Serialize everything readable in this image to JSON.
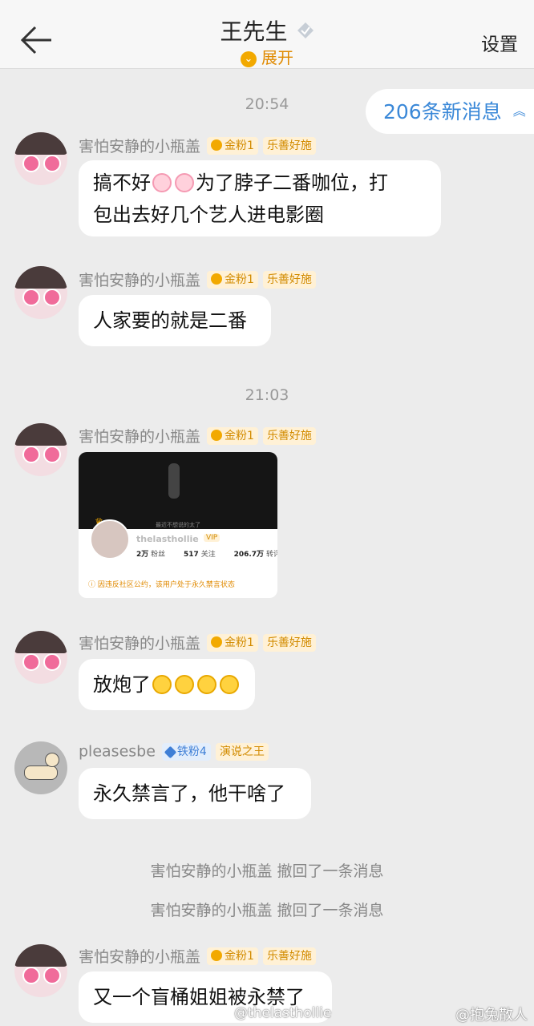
{
  "header": {
    "title": "王先生",
    "expand_label": "展开",
    "settings_label": "设置"
  },
  "new_messages": {
    "label": "206条新消息"
  },
  "times": [
    "20:54",
    "21:03"
  ],
  "user1": {
    "name": "害怕安静的小瓶盖",
    "fan_level": "金粉1",
    "tag": "乐善好施"
  },
  "user2": {
    "name": "pleasesbe",
    "fan_level": "铁粉4",
    "tag": "演说之王"
  },
  "messages": {
    "m1_line1_a": "搞不好",
    "m1_line1_b": "为了脖子二番咖位，打",
    "m1_line2": "包出去好几个艺人进电影圈",
    "m2": "人家要的就是二番",
    "m4": "放炮了",
    "m5": "永久禁言了，他干啥了",
    "m6": "又一个盲桶姐姐被永禁了"
  },
  "image_card": {
    "caption": "最近不想说的太了",
    "name": "thelasthollie",
    "vip": "VIP",
    "followers_num": "2万",
    "followers_label": "粉丝",
    "following_num": "517",
    "following_label": "关注",
    "reposts_num": "206.7万",
    "reposts_label": "转评赞",
    "notice": "因违反社区公约，该用户处于永久禁言状态"
  },
  "recall_notices": [
    "害怕安静的小瓶盖 撤回了一条消息",
    "害怕安静的小瓶盖 撤回了一条消息"
  ],
  "watermark": {
    "left": "@thelasthollie",
    "right": "@抱兔散人"
  },
  "colors": {
    "accent_orange": "#f2a900",
    "link_blue": "#3a88d8",
    "bg": "#ececec"
  }
}
